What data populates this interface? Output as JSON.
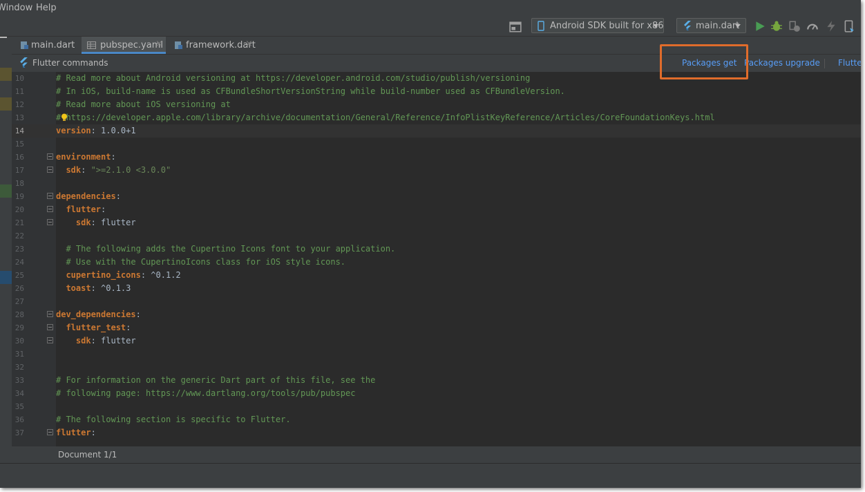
{
  "menu": {
    "window": "Window",
    "help": "Help"
  },
  "toolbar": {
    "device": "Android SDK built for x86",
    "run_config": "main.dart",
    "icons": [
      "terminal-icon",
      "device-icon",
      "flutter-icon",
      "run-icon",
      "debug-icon",
      "attach-icon",
      "profile-icon",
      "hot-reload-icon",
      "device-manager-icon"
    ],
    "colors": {
      "run": "#499c54",
      "debug": "#76a63e",
      "flutter": "#5aaee6"
    }
  },
  "tabs": [
    {
      "label": "main.dart",
      "active": false
    },
    {
      "label": "pubspec.yaml",
      "active": true
    },
    {
      "label": "framework.dart",
      "active": false
    }
  ],
  "flutter_commands": {
    "title": "Flutter commands",
    "packages_get": "Packages get",
    "packages_upgrade": "Packages upgrade",
    "flutter_more": "Flutter",
    "link_color": "#589df6",
    "highlight_color": "#e06c2b"
  },
  "editor": {
    "current_line": "14",
    "lines": [
      {
        "n": "10",
        "c": "# Read more about Android versioning at https://developer.android.com/studio/publish/versioning"
      },
      {
        "n": "11",
        "c": "# In iOS, build-name is used as CFBundleShortVersionString while build-number used as CFBundleVersion."
      },
      {
        "n": "12",
        "c": "# Read more about iOS versioning at"
      },
      {
        "n": "13",
        "c": "# https://developer.apple.com/library/archive/documentation/General/Reference/InfoPlistKeyReference/Articles/CoreFoundationKeys.html"
      },
      {
        "n": "14",
        "k": "version",
        "v": ": 1.0.0+1"
      },
      {
        "n": "15"
      },
      {
        "n": "16",
        "k": "environment",
        "v": ":"
      },
      {
        "n": "17",
        "k": "  sdk",
        "v": ": ",
        "s": "\">=2.1.0 <3.0.0\""
      },
      {
        "n": "18"
      },
      {
        "n": "19",
        "k": "dependencies",
        "v": ":"
      },
      {
        "n": "20",
        "k": "  flutter",
        "v": ":"
      },
      {
        "n": "21",
        "k": "    sdk",
        "v": ": flutter"
      },
      {
        "n": "22"
      },
      {
        "n": "23",
        "c": "  # The following adds the Cupertino Icons font to your application."
      },
      {
        "n": "24",
        "c": "  # Use with the CupertinoIcons class for iOS style icons."
      },
      {
        "n": "25",
        "k": "  cupertino_icons",
        "v": ": ^0.1.2"
      },
      {
        "n": "26",
        "k": "  toast",
        "v": ": ^0.1.3"
      },
      {
        "n": "27"
      },
      {
        "n": "28",
        "k": "dev_dependencies",
        "v": ":"
      },
      {
        "n": "29",
        "k": "  flutter_test",
        "v": ":"
      },
      {
        "n": "30",
        "k": "    sdk",
        "v": ": flutter"
      },
      {
        "n": "31"
      },
      {
        "n": "32"
      },
      {
        "n": "33",
        "c": "# For information on the generic Dart part of this file, see the"
      },
      {
        "n": "34",
        "c": "# following page: https://www.dartlang.org/tools/pub/pubspec"
      },
      {
        "n": "35"
      },
      {
        "n": "36",
        "c": "# The following section is specific to Flutter."
      },
      {
        "n": "37",
        "k": "flutter",
        "v": ":"
      }
    ]
  },
  "status": {
    "document": "Document 1/1"
  }
}
